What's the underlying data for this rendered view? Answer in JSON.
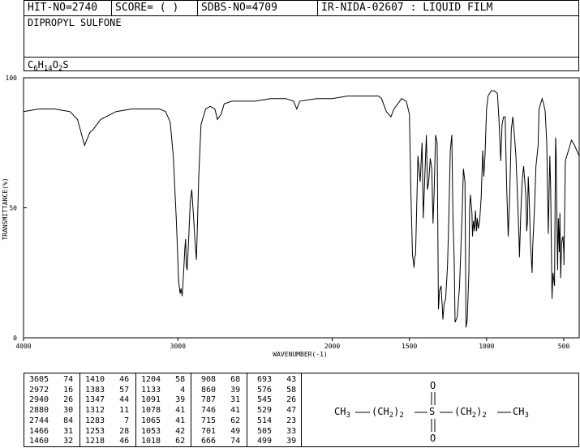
{
  "header": {
    "hit_no": "HIT-NO=2740",
    "score": "SCORE=  (  )",
    "sdbs_no": "SDBS-NO=4709",
    "ir_nida": "IR-NIDA-02607 : LIQUID FILM",
    "compound": "DIPROPYL SULFONE",
    "formula_parts": [
      "C",
      "6",
      "H",
      "14",
      "O",
      "2",
      "S"
    ]
  },
  "chart_data": {
    "type": "line",
    "title": "",
    "xlabel": "WAVENUMBER(-1)",
    "ylabel": "TRANSMITTANCE(%)",
    "xlim": [
      4000,
      400
    ],
    "ylim": [
      0,
      100
    ],
    "x_ticks": [
      4000,
      3000,
      2000,
      1500,
      1000,
      500
    ],
    "y_ticks": [
      0,
      50,
      100
    ],
    "grid": false,
    "series": [
      {
        "color": "#000000",
        "x": [
          4000,
          3900,
          3800,
          3700,
          3650,
          3605,
          3570,
          3550,
          3500,
          3400,
          3300,
          3200,
          3120,
          3080,
          3050,
          3030,
          3010,
          2995,
          2985,
          2980,
          2972,
          2962,
          2955,
          2950,
          2945,
          2940,
          2930,
          2920,
          2910,
          2900,
          2890,
          2880,
          2875,
          2865,
          2850,
          2820,
          2790,
          2760,
          2744,
          2720,
          2700,
          2650,
          2600,
          2500,
          2400,
          2300,
          2250,
          2230,
          2210,
          2100,
          2000,
          1900,
          1800,
          1750,
          1700,
          1680,
          1650,
          1620,
          1600,
          1550,
          1520,
          1500,
          1490,
          1480,
          1470,
          1466,
          1460,
          1455,
          1445,
          1430,
          1418,
          1410,
          1400,
          1390,
          1383,
          1375,
          1365,
          1355,
          1347,
          1340,
          1330,
          1320,
          1312,
          1305,
          1295,
          1287,
          1283,
          1275,
          1265,
          1253,
          1245,
          1235,
          1225,
          1218,
          1210,
          1204,
          1190,
          1175,
          1160,
          1150,
          1140,
          1133,
          1125,
          1115,
          1110,
          1105,
          1095,
          1091,
          1085,
          1078,
          1072,
          1065,
          1060,
          1053,
          1045,
          1035,
          1025,
          1018,
          1010,
          1000,
          990,
          970,
          950,
          930,
          920,
          908,
          900,
          890,
          880,
          870,
          860,
          850,
          840,
          830,
          820,
          810,
          800,
          790,
          787,
          780,
          770,
          760,
          746,
          740,
          735,
          730,
          725,
          715,
          705,
          701,
          690,
          680,
          666,
          660,
          650,
          640,
          630,
          620,
          610,
          600,
          590,
          585,
          576,
          570,
          560,
          553,
          550,
          545,
          540,
          535,
          529,
          525,
          520,
          514,
          510,
          505,
          500,
          499,
          490,
          470,
          450,
          430,
          415,
          400
        ],
        "y": [
          87,
          88,
          88,
          87,
          84,
          74,
          79,
          80,
          84,
          87,
          88,
          88,
          88,
          87,
          83,
          70,
          45,
          22,
          17,
          19,
          16,
          26,
          34,
          38,
          28,
          26,
          38,
          52,
          57,
          48,
          38,
          30,
          40,
          62,
          82,
          88,
          89,
          88,
          84,
          86,
          90,
          91,
          91,
          91,
          92,
          92,
          91,
          88,
          91,
          92,
          92,
          93,
          93,
          93,
          93,
          92,
          87,
          85,
          88,
          92,
          91,
          86,
          55,
          32,
          27,
          31,
          32,
          45,
          70,
          60,
          75,
          46,
          62,
          78,
          57,
          60,
          69,
          65,
          44,
          55,
          78,
          75,
          11,
          18,
          20,
          12,
          7,
          13,
          15,
          28,
          45,
          72,
          78,
          46,
          30,
          6,
          8,
          20,
          45,
          65,
          60,
          4,
          7,
          25,
          50,
          55,
          48,
          39,
          45,
          41,
          49,
          41,
          46,
          42,
          45,
          54,
          72,
          62,
          70,
          88,
          93,
          95,
          95,
          94,
          84,
          68,
          82,
          85,
          85,
          58,
          39,
          55,
          80,
          85,
          78,
          70,
          55,
          38,
          31,
          45,
          60,
          66,
          55,
          41,
          45,
          62,
          55,
          35,
          25,
          35,
          49,
          66,
          74,
          88,
          90,
          92,
          90,
          87,
          75,
          40,
          70,
          58,
          15,
          25,
          20,
          77,
          72,
          49,
          26,
          46,
          33,
          48,
          23,
          36,
          38,
          39,
          33,
          28,
          68,
          72,
          76,
          74,
          72,
          70
        ]
      }
    ]
  },
  "peak_table": [
    [
      {
        "wn": "3605",
        "t": "74"
      },
      {
        "wn": "2972",
        "t": "16"
      },
      {
        "wn": "2940",
        "t": "26"
      },
      {
        "wn": "2880",
        "t": "30"
      },
      {
        "wn": "2744",
        "t": "84"
      },
      {
        "wn": "1466",
        "t": "31"
      },
      {
        "wn": "1460",
        "t": "32"
      }
    ],
    [
      {
        "wn": "1410",
        "t": "46"
      },
      {
        "wn": "1383",
        "t": "57"
      },
      {
        "wn": "1347",
        "t": "44"
      },
      {
        "wn": "1312",
        "t": "11"
      },
      {
        "wn": "1283",
        "t": " 7"
      },
      {
        "wn": "1253",
        "t": "28"
      },
      {
        "wn": "1218",
        "t": "46"
      }
    ],
    [
      {
        "wn": "1204",
        "t": "58"
      },
      {
        "wn": "1133",
        "t": " 4"
      },
      {
        "wn": "1091",
        "t": "39"
      },
      {
        "wn": "1078",
        "t": "41"
      },
      {
        "wn": "1065",
        "t": "41"
      },
      {
        "wn": "1053",
        "t": "42"
      },
      {
        "wn": "1018",
        "t": "62"
      }
    ],
    [
      {
        "wn": " 908",
        "t": "68"
      },
      {
        "wn": " 860",
        "t": "39"
      },
      {
        "wn": " 787",
        "t": "31"
      },
      {
        "wn": " 746",
        "t": "41"
      },
      {
        "wn": " 715",
        "t": "62"
      },
      {
        "wn": " 701",
        "t": "49"
      },
      {
        "wn": " 666",
        "t": "74"
      }
    ],
    [
      {
        "wn": " 693",
        "t": "43"
      },
      {
        "wn": " 576",
        "t": "58"
      },
      {
        "wn": " 545",
        "t": "26"
      },
      {
        "wn": " 529",
        "t": "47"
      },
      {
        "wn": " 514",
        "t": "23"
      },
      {
        "wn": " 505",
        "t": "33"
      },
      {
        "wn": " 499",
        "t": "39"
      }
    ]
  ],
  "structure": {
    "top_o": "O",
    "bottom_o": "O",
    "s": "S",
    "left_ch3": "CH",
    "left_ch3_sub": "3",
    "left_group": "(CH",
    "left_group_sub": "2",
    "left_group_close": ")",
    "left_group_count": "2",
    "right_group": "(CH",
    "right_group_sub": "2",
    "right_group_close": ")",
    "right_group_count": "2",
    "right_ch3": "CH",
    "right_ch3_sub": "3"
  }
}
